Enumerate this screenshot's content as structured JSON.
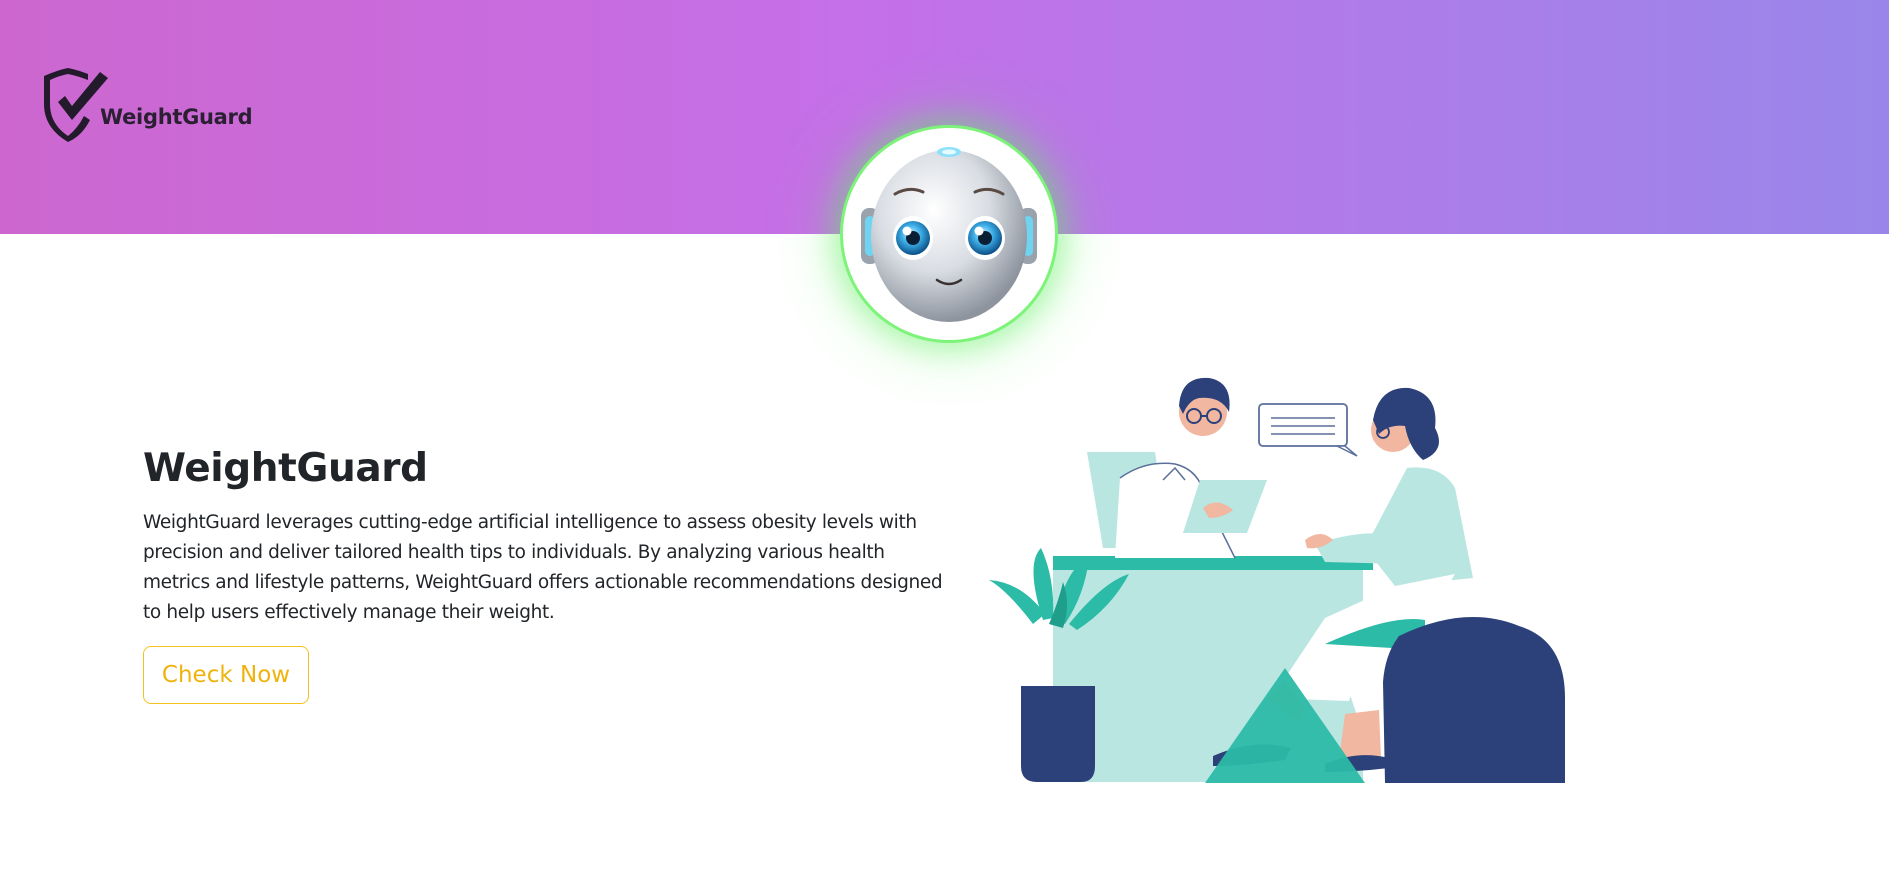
{
  "header": {
    "brand_name": "WeightGuard",
    "gradient_colors": [
      "#cd67cf",
      "#c56fe8",
      "#9a86ea"
    ],
    "logo_icon": "shield-check-icon"
  },
  "avatar": {
    "icon": "robot-face",
    "ring_color": "#7df37a"
  },
  "hero": {
    "title": "WeightGuard",
    "description": "WeightGuard leverages cutting-edge artificial intelligence to assess obesity levels with precision and deliver tailored health tips to individuals. By analyzing various health metrics and lifestyle patterns, WeightGuard offers actionable recommendations designed to help users effectively manage their weight.",
    "cta_label": "Check Now",
    "cta_color": "#f4c21f"
  },
  "illustration": {
    "subject": "doctor-consultation-illustration",
    "colors": [
      "#2c417a",
      "#b9e6e1",
      "#2bbba7"
    ]
  }
}
